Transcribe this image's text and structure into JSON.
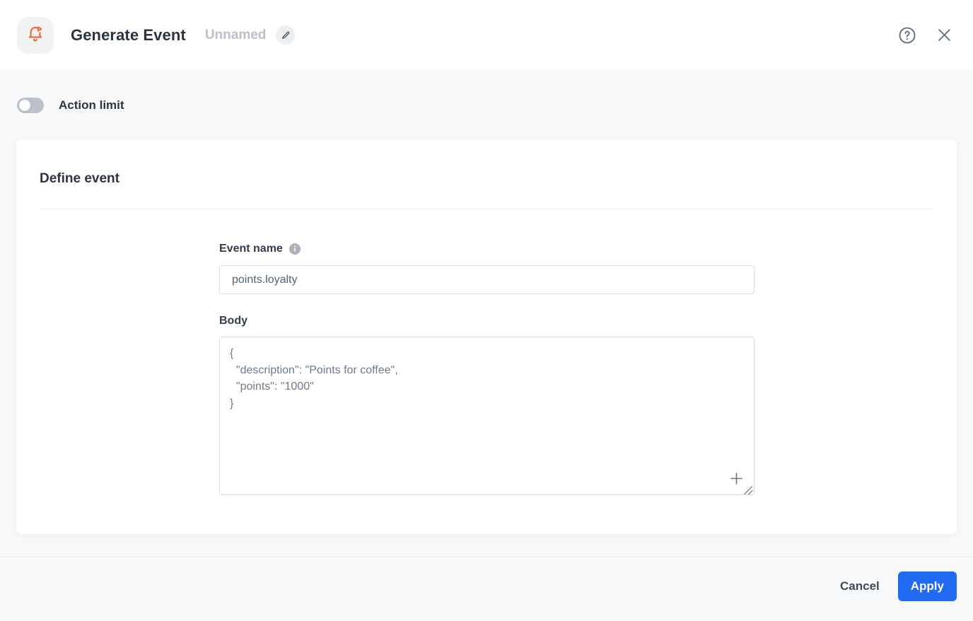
{
  "header": {
    "title": "Generate Event",
    "subtitle": "Unnamed"
  },
  "action_limit": {
    "label": "Action limit",
    "enabled": false
  },
  "card": {
    "title": "Define event",
    "event_name": {
      "label": "Event name",
      "value": "points.loyalty"
    },
    "body": {
      "label": "Body",
      "value": "{\n  \"description\": \"Points for coffee\",\n  \"points\": \"1000\"\n}"
    }
  },
  "footer": {
    "cancel_label": "Cancel",
    "apply_label": "Apply"
  },
  "icons": {
    "app": "bell-play-icon",
    "edit": "pencil-icon",
    "help": "question-circle-icon",
    "close": "x-icon",
    "info": "info-circle-icon",
    "add": "plus-icon",
    "resize": "resize-corner-icon"
  },
  "colors": {
    "accent_orange": "#f2682c",
    "primary_blue": "#1f6af0",
    "page_background": "#f7f8f9",
    "icon_gray": "#5d6b7a",
    "muted_text": "#b9c1ca",
    "border": "#d9dde2"
  }
}
